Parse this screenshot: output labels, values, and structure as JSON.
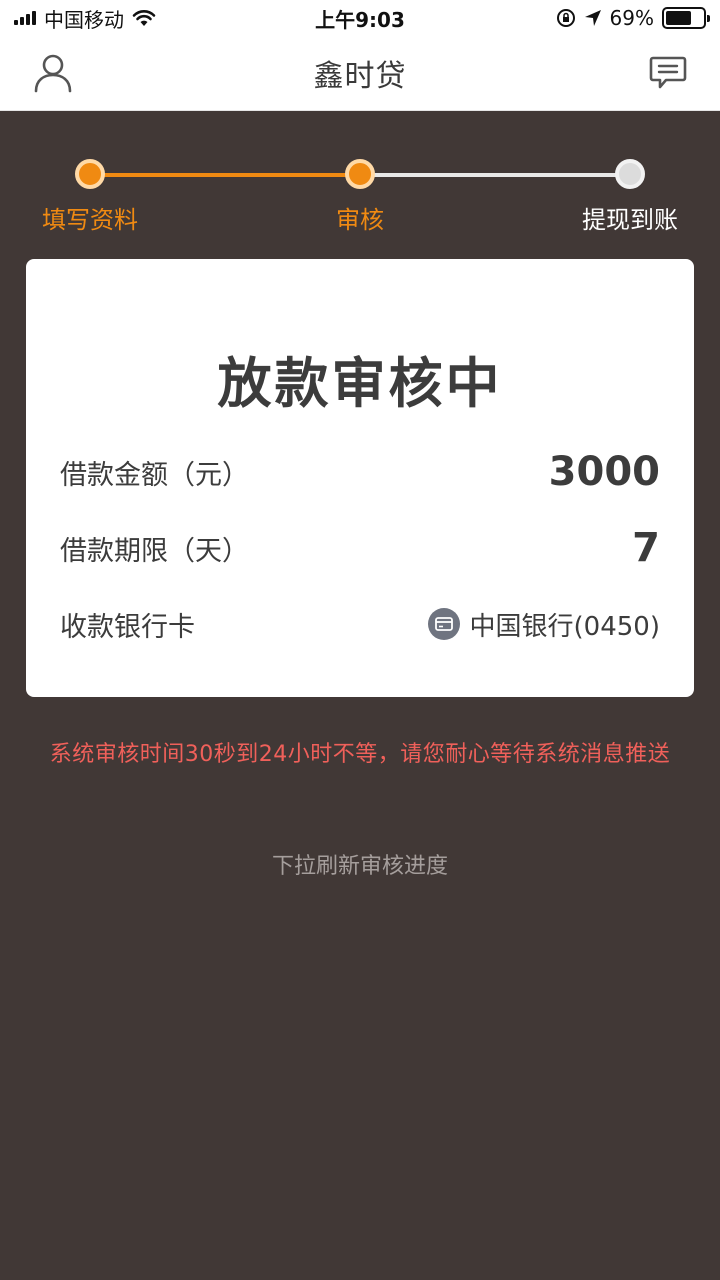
{
  "status_bar": {
    "carrier": "中国移动",
    "time": "上午9:03",
    "battery_percent": "69%",
    "battery_level": 0.69,
    "icons": [
      "signal-icon",
      "wifi-icon",
      "rotation-lock-icon",
      "location-arrow-icon",
      "battery-icon"
    ]
  },
  "nav": {
    "title": "鑫时贷",
    "left_icon": "user-icon",
    "right_icon": "message-icon"
  },
  "steps": {
    "items": [
      {
        "label": "填写资料",
        "state": "done"
      },
      {
        "label": "审核",
        "state": "current"
      },
      {
        "label": "提现到账",
        "state": "pending"
      }
    ],
    "colors": {
      "active": "#f08a12",
      "pending": "#dcdcdc"
    }
  },
  "card": {
    "title": "放款审核中",
    "rows": [
      {
        "label": "借款金额（元）",
        "value": "3000"
      },
      {
        "label": "借款期限（天）",
        "value": "7"
      },
      {
        "label": "收款银行卡",
        "value": "中国银行(0450)",
        "icon": "bank-card-icon"
      }
    ]
  },
  "notice": "系统审核时间30秒到24小时不等，请您耐心等待系统消息推送",
  "pull_hint": "下拉刷新审核进度",
  "colors": {
    "background": "#413836",
    "accent": "#f08a12",
    "notice": "#f0605a"
  }
}
